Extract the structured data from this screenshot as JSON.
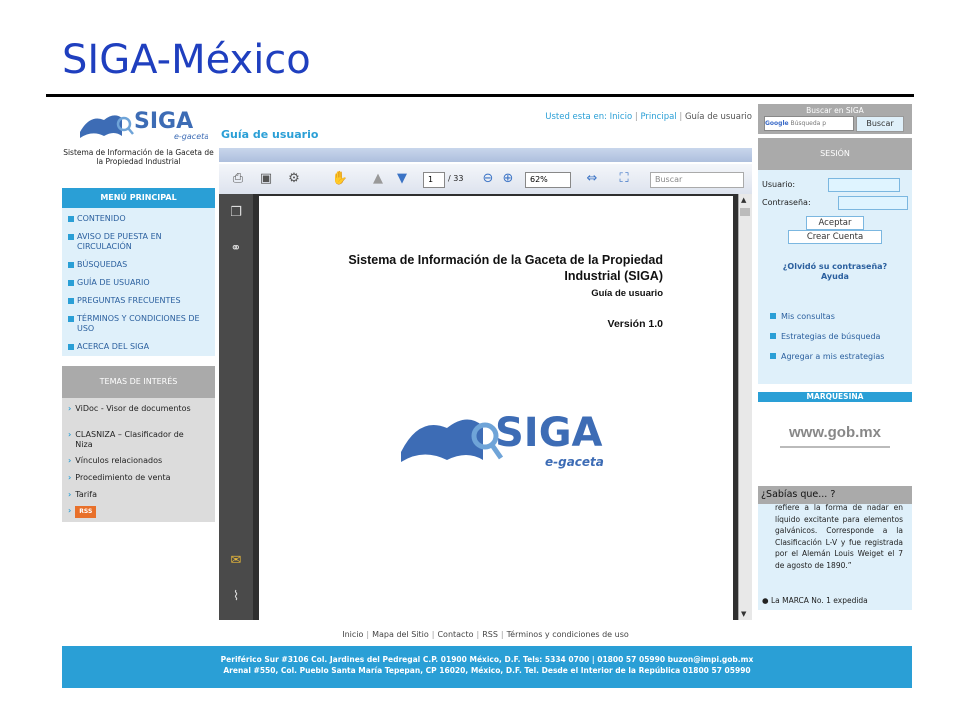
{
  "slide": {
    "title": "SIGA-México"
  },
  "left": {
    "logo_text": "SIGA",
    "logo_sub": "e-gaceta",
    "tagline": "Sistema de Información de la Gaceta de la Propiedad Industrial",
    "menu_title": "MENÚ PRINCIPAL",
    "menu_items": [
      "CONTENIDO",
      "AVISO DE PUESTA EN CIRCULACIÓN",
      "BÚSQUEDAS",
      "GUÍA DE USUARIO",
      "PREGUNTAS FRECUENTES",
      "TÉRMINOS Y CONDICIONES DE USO",
      "ACERCA DEL SIGA"
    ],
    "temas_title": "TEMAS DE INTERÉS",
    "temas_items": [
      "ViDoc - Visor de documentos",
      "CLASNIZA – Clasificador de Niza",
      "Vínculos relacionados",
      "Procedimiento de venta",
      "Tarifa"
    ],
    "rss_label": "RSS"
  },
  "center": {
    "breadcrumb": {
      "prefix": "Usted esta en:",
      "inicio": "Inicio",
      "principal": "Principal",
      "current": "Guía de usuario"
    },
    "page_title": "Guía de usuario",
    "pdf": {
      "page": "1",
      "of": "/ 33",
      "zoom": "62%",
      "search_placeholder": "Buscar",
      "doc_title": "Sistema de Información de la Gaceta de la Propiedad Industrial (SIGA)",
      "doc_subtitle": "Guía de usuario",
      "doc_version": "Versión 1.0",
      "doc_logo": "SIGA",
      "doc_logo_sub": "e-gaceta"
    }
  },
  "footer": {
    "links": [
      "Inicio",
      "Mapa del Sitio",
      "Contacto",
      "RSS",
      "Términos y condiciones de uso"
    ],
    "address1": "Periférico Sur #3106 Col. Jardines del Pedregal C.P. 01900 México, D.F. Tels: 5334 0700 | 01800 57 05990  buzon@impi.gob.mx",
    "address2": "Arenal #550, Col. Pueblo Santa María Tepepan, CP 16020, México, D.F. Tel. Desde el Interior de la República 01800 57 05990"
  },
  "right": {
    "search_title": "Buscar en SIGA",
    "search_google": "Google",
    "search_placeholder": "Búsqueda p",
    "search_button": "Buscar",
    "session_title": "SESIÓN",
    "user_label": "Usuario:",
    "pass_label": "Contraseña:",
    "accept_button": "Aceptar",
    "create_button": "Crear Cuenta",
    "forgot_line1": "¿Olvidó su contraseña?",
    "forgot_line2": "Ayuda",
    "links": [
      "Mis consultas",
      "Estrategias de búsqueda",
      "Agregar a mis estrategias"
    ],
    "marquee_title": "MARQUESINA",
    "gob": "www.gob.mx",
    "sabias_title": "¿Sabías que... ?",
    "sabias_text": "refiere a la forma de nadar en líquido excitante para elementos galvánicos. Corresponde a la Clasificación L-V y fue registrada por el Alemán Louis Weiget el 7 de agosto de 1890.”",
    "sabias_next": "La MARCA No. 1 expedida"
  },
  "colors": {
    "accent": "#2a9fd6",
    "title": "#1f3fbf",
    "gray_header": "#aaaaaa",
    "light_blue": "#dff0fa"
  }
}
